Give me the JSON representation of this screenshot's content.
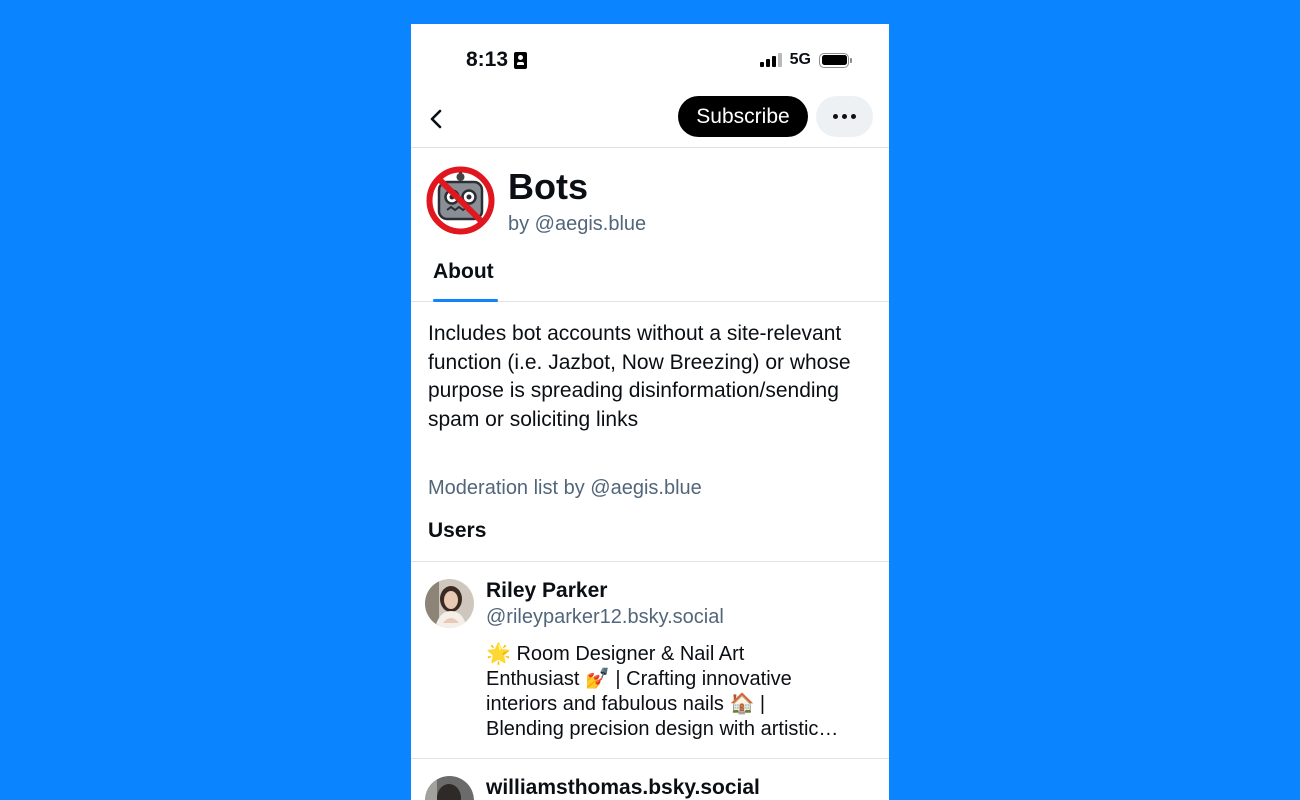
{
  "status_bar": {
    "time": "8:13",
    "network": "5G"
  },
  "header": {
    "subscribe_label": "Subscribe"
  },
  "list": {
    "title": "Bots",
    "byline": "by @aegis.blue",
    "tabs": [
      {
        "label": "About",
        "active": true
      }
    ],
    "description": "Includes bot accounts without a site-relevant function (i.e. Jazbot, Now Breezing) or whose purpose is spreading disinformation/sending spam or soliciting links",
    "moderation_note": "Moderation list by @aegis.blue",
    "section_title": "Users"
  },
  "users": [
    {
      "name": "Riley Parker",
      "handle": "@rileyparker12.bsky.social",
      "bio": "🌟 Room Designer & Nail Art\nEnthusiast 💅 | Crafting innovative\ninteriors and fabulous nails 🏠 |\nBlending precision design with artistic…"
    },
    {
      "name": "williamsthomas.bsky.social"
    }
  ],
  "colors": {
    "accent": "#1083fe",
    "background": "#0a84ff",
    "muted_text": "#52667a"
  },
  "icons": [
    "id-badge-icon",
    "signal-icon",
    "battery-icon",
    "back-chevron-icon",
    "more-dots-icon",
    "no-robots-icon"
  ]
}
